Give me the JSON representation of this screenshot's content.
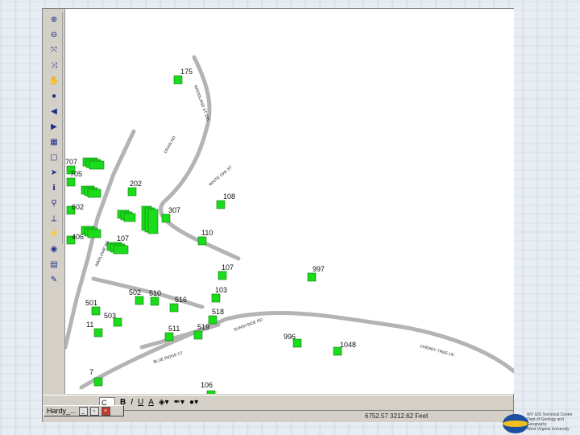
{
  "map": {
    "parcels": [
      {
        "label": "175"
      },
      {
        "label": "108"
      },
      {
        "label": "307"
      },
      {
        "label": "202"
      },
      {
        "label": "110"
      },
      {
        "label": "107"
      },
      {
        "label": "107"
      },
      {
        "label": "997"
      },
      {
        "label": "103"
      },
      {
        "label": "502"
      },
      {
        "label": "510"
      },
      {
        "label": "516"
      },
      {
        "label": "518"
      },
      {
        "label": "501"
      },
      {
        "label": "503"
      },
      {
        "label": "511"
      },
      {
        "label": "519"
      },
      {
        "label": "11"
      },
      {
        "label": "996"
      },
      {
        "label": "1048"
      },
      {
        "label": "7"
      },
      {
        "label": "106"
      },
      {
        "label": "707"
      },
      {
        "label": "705"
      },
      {
        "label": "602"
      },
      {
        "label": "406"
      }
    ],
    "road_labels": [
      "WOODLAND ST 105",
      "CRAIN RD",
      "WHITE OAK ST",
      "MARLOWE RD",
      "BLUE RIDGE CT",
      "SUNNYSIDE RD",
      "CHERRY TREE LN"
    ]
  },
  "draw_toolbar": {
    "font_select": "C",
    "bold": "B",
    "italic": "I",
    "underline": "U",
    "font_color": "A"
  },
  "status": {
    "text": "6752.57 3212.62 Feet"
  },
  "taskbar": {
    "label": "Hardy_..."
  },
  "logo": {
    "line1": "WV GIS Technical Center",
    "line2": "Dept of Geology and Geography",
    "line3": "West Virginia University"
  },
  "colors": {
    "parcel_fill": "#1adc1a",
    "road": "#b4b4b4",
    "map_bg": "#ffffff"
  }
}
